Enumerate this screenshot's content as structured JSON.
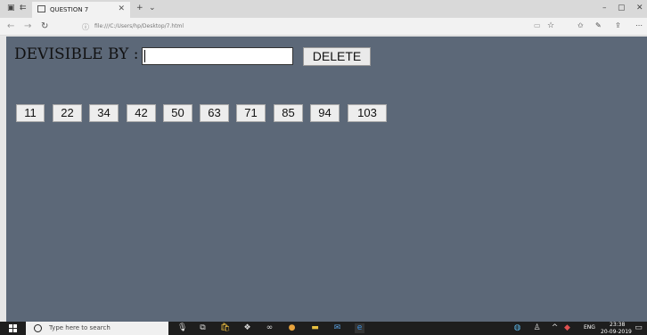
{
  "tab": {
    "title": "QUESTION 7"
  },
  "address": {
    "url": "file:///C:/Users/hp/Desktop/7.html"
  },
  "page": {
    "label": "DEVISIBLE BY :",
    "input_value": "",
    "delete_label": "DELETE",
    "numbers": [
      "11",
      "22",
      "34",
      "42",
      "50",
      "63",
      "71",
      "85",
      "94",
      "103"
    ]
  },
  "taskbar": {
    "search_placeholder": "Type here to search",
    "lang": "ENG",
    "time": "23:38",
    "date": "20-09-2019"
  },
  "colors": {
    "page_bg": "#5c6878",
    "button_bg": "#ededed"
  }
}
